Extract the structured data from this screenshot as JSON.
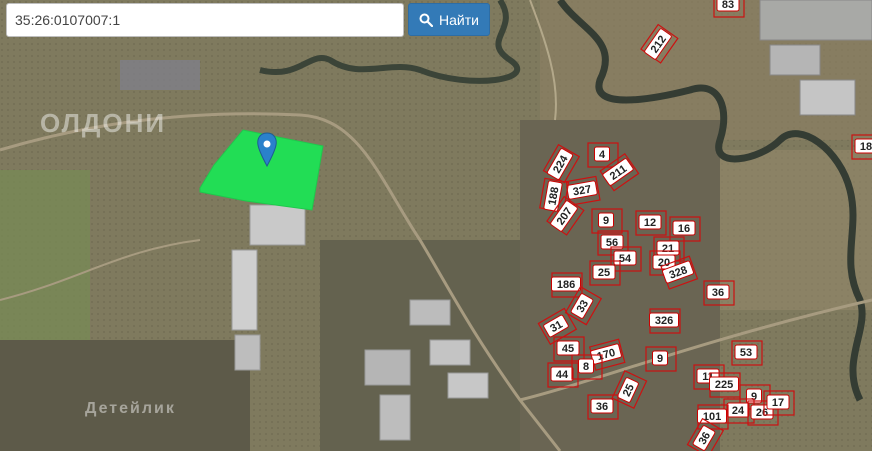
{
  "search": {
    "value": "35:26:0107007:1",
    "button_label": "Найти"
  },
  "watermarks": {
    "top": "ОЛДОНИ",
    "bottom": "Детейлик"
  },
  "parcels": [
    "83",
    "212",
    "18",
    "224",
    "4",
    "327",
    "211",
    "188",
    "207",
    "9",
    "12",
    "16",
    "56",
    "21",
    "54",
    "20",
    "25",
    "328",
    "186",
    "33",
    "36",
    "31",
    "326",
    "45",
    "170",
    "9",
    "53",
    "44",
    "8",
    "11",
    "225",
    "25",
    "9",
    "36",
    "24",
    "26",
    "17",
    "101",
    "36"
  ],
  "colors": {
    "highlight": "#22dd55",
    "parcel_border": "#cc1111",
    "button": "#337ab7"
  }
}
